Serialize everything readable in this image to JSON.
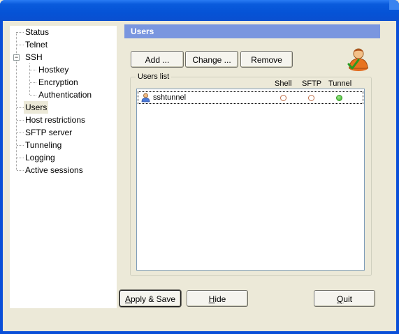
{
  "window": {
    "title": ""
  },
  "tree": {
    "items": [
      {
        "label": "Status"
      },
      {
        "label": "Telnet"
      },
      {
        "label": "SSH"
      },
      {
        "label": "Hostkey"
      },
      {
        "label": "Encryption"
      },
      {
        "label": "Authentication"
      },
      {
        "label": "Users"
      },
      {
        "label": "Host restrictions"
      },
      {
        "label": "SFTP server"
      },
      {
        "label": "Tunneling"
      },
      {
        "label": "Logging"
      },
      {
        "label": "Active sessions"
      }
    ],
    "selected": "Users",
    "ssh_expander": "−"
  },
  "panel": {
    "title": "Users",
    "buttons": {
      "add": "Add ...",
      "change": "Change ...",
      "remove": "Remove"
    },
    "users_list": {
      "label": "Users list",
      "columns": [
        "Shell",
        "SFTP",
        "Tunnel"
      ],
      "rows": [
        {
          "name": "sshtunnel",
          "shell": false,
          "sftp": false,
          "tunnel": true
        }
      ]
    }
  },
  "footer": {
    "apply_save": "Apply & Save",
    "hide": "Hide",
    "quit": "Quit"
  },
  "colors": {
    "panel_header": "#7a96df",
    "titlebar": "#0553d6",
    "enabled": "#2fae22",
    "disabled": "#c0704a"
  }
}
